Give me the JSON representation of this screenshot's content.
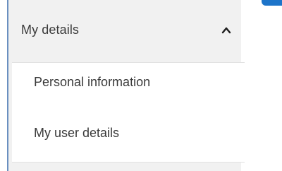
{
  "sidebar": {
    "section": {
      "title": "My details",
      "chevron_icon": "chevron-up-icon",
      "items": [
        {
          "label": "Personal information"
        },
        {
          "label": "My user details"
        }
      ]
    }
  },
  "colors": {
    "panel_background": "#f1f1f1",
    "submenu_background": "#ffffff",
    "accent": "#1d74c9",
    "text": "#3a3a3a",
    "left_border": "#6a8fc0"
  }
}
